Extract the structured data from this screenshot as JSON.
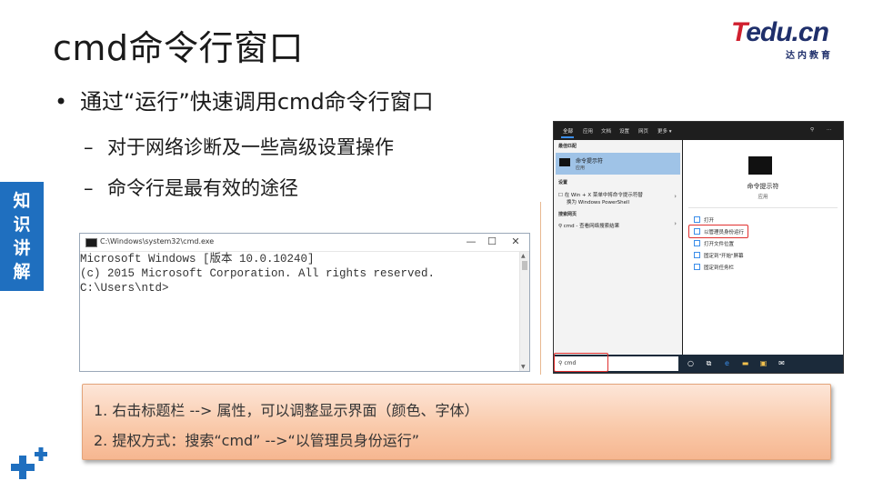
{
  "slide": {
    "title": "cmd命令行窗口",
    "bullet1": "通过“运行”快速调用cmd命令行窗口",
    "sub1": "对于网络诊断及一些高级设置操作",
    "sub2": "命令行是最有效的途径",
    "bullet_marker": "•",
    "dash_marker": "–"
  },
  "logo": {
    "brand_t": "T",
    "brand_rest": "edu.cn",
    "subtitle": "达内教育"
  },
  "side_tab": {
    "chars": [
      "知",
      "识",
      "讲",
      "解"
    ],
    "color": "#1f6fbf"
  },
  "cmd_window": {
    "title": "C:\\Windows\\system32\\cmd.exe",
    "minimize": "—",
    "maximize": "☐",
    "close": "✕",
    "lines": [
      "Microsoft Windows [版本 10.0.10240]",
      "(c) 2015 Microsoft Corporation. All rights reserved.",
      "",
      "C:\\Users\\ntd>"
    ]
  },
  "start_menu": {
    "tabs": [
      "全部",
      "应用",
      "文档",
      "设置",
      "网页",
      "更多 ▾"
    ],
    "sections": {
      "best_match": "最佳匹配",
      "settings": "设置",
      "search_web": "搜索网页"
    },
    "best_match_name": "命令提示符",
    "best_match_type": "应用",
    "settings_item_line1": "在 Win + X 菜单中将命令提示符替",
    "settings_item_line2": "换为 Windows PowerShell",
    "web_item": "cmd - 查看网络搜索结果",
    "app_name": "命令提示符",
    "app_type": "应用",
    "actions": [
      "打开",
      "以管理员身份运行",
      "打开文件位置",
      "固定到\"开始\"屏幕",
      "固定到任务栏"
    ],
    "search_query": "cmd",
    "highlight_color": "#e0302f"
  },
  "notes": {
    "line1": "1. 右击标题栏 --> 属性，可以调整显示界面（颜色、字体）",
    "line2": "2. 提权方式：搜索“cmd” -->“以管理员身份运行”"
  }
}
